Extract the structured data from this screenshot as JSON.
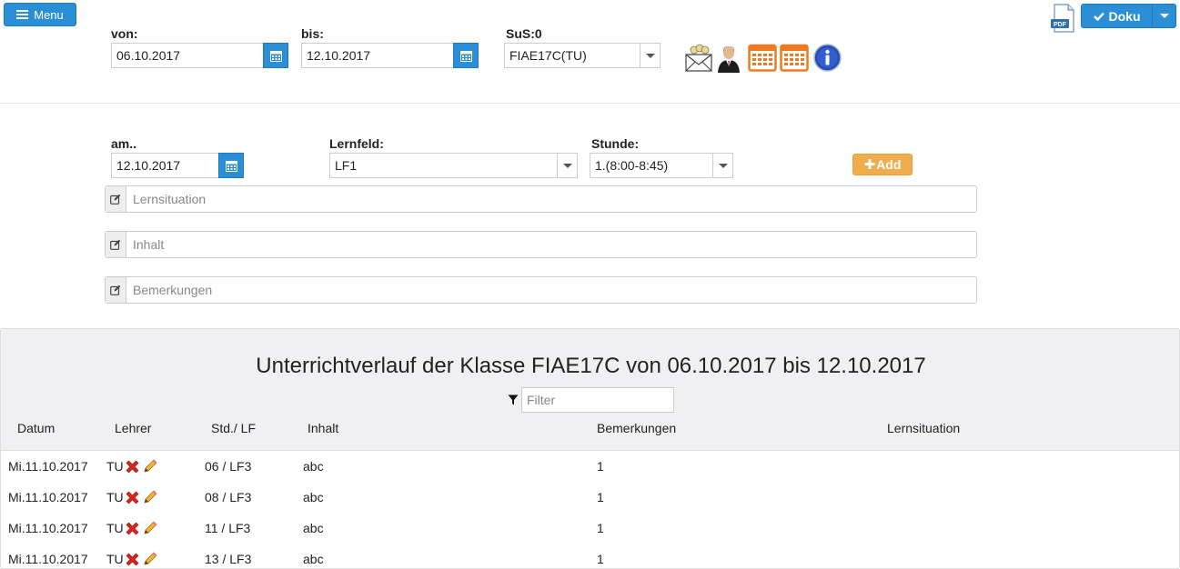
{
  "menu": {
    "label": "Menu"
  },
  "doku": {
    "label": "Doku",
    "pdf_label": "PDF"
  },
  "filter": {
    "von_label": "von:",
    "von_value": "06.10.2017",
    "bis_label": "bis:",
    "bis_value": "12.10.2017",
    "sus_label": "SuS:0",
    "sus_value": "FIAE17C(TU)"
  },
  "form": {
    "am_label": "am..",
    "am_value": "12.10.2017",
    "lernfeld_label": "Lernfeld:",
    "lernfeld_value": "LF1",
    "stunde_label": "Stunde:",
    "stunde_value": "1.(8:00-8:45)",
    "add_label": "Add",
    "lernsituation_placeholder": "Lernsituation",
    "inhalt_placeholder": "Inhalt",
    "bemerkungen_placeholder": "Bemerkungen"
  },
  "table": {
    "title": "Unterrichtverlauf der Klasse FIAE17C von 06.10.2017 bis 12.10.2017",
    "filter_placeholder": "Filter",
    "headers": [
      "Datum",
      "Lehrer",
      "Std./ LF",
      "Inhalt",
      "Bemerkungen",
      "Lernsituation"
    ],
    "rows": [
      {
        "datum": "Mi.11.10.2017",
        "lehrer": "TU",
        "std": "06 / LF3",
        "inhalt": "abc",
        "bemerkungen": "1",
        "lernsituation": ""
      },
      {
        "datum": "Mi.11.10.2017",
        "lehrer": "TU",
        "std": "08 / LF3",
        "inhalt": "abc",
        "bemerkungen": "1",
        "lernsituation": ""
      },
      {
        "datum": "Mi.11.10.2017",
        "lehrer": "TU",
        "std": "11 / LF3",
        "inhalt": "abc",
        "bemerkungen": "1",
        "lernsituation": ""
      },
      {
        "datum": "Mi.11.10.2017",
        "lehrer": "TU",
        "std": "13 / LF3",
        "inhalt": "abc",
        "bemerkungen": "1",
        "lernsituation": ""
      }
    ]
  },
  "colors": {
    "primary": "#2a8fd6",
    "warning": "#f0ad4e",
    "orange_icon": "#ef7a22",
    "delete_red": "#d9251d"
  }
}
